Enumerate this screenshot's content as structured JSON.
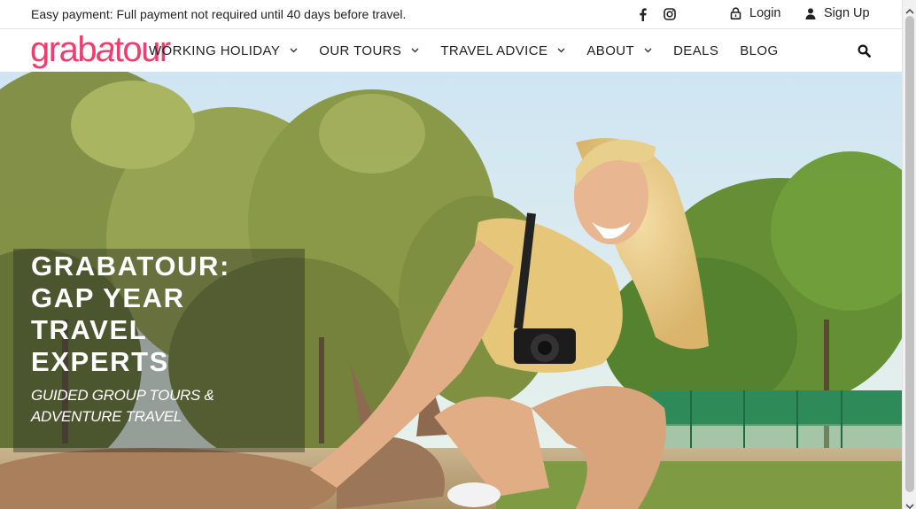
{
  "topbar": {
    "promo": "Easy payment: Full payment not required until 40 days before travel.",
    "login_label": "Login",
    "signup_label": "Sign Up"
  },
  "brand": {
    "logo_parts": [
      "grab",
      "a",
      "tour"
    ],
    "accent_color": "#ef3d6d"
  },
  "nav": {
    "items": [
      {
        "label": "WORKING HOLIDAY",
        "has_dropdown": true
      },
      {
        "label": "OUR TOURS",
        "has_dropdown": true
      },
      {
        "label": "TRAVEL ADVICE",
        "has_dropdown": true
      },
      {
        "label": "ABOUT",
        "has_dropdown": true
      },
      {
        "label": "DEALS",
        "has_dropdown": false
      },
      {
        "label": "BLOG",
        "has_dropdown": false
      }
    ]
  },
  "icons": {
    "facebook": "facebook-icon",
    "instagram": "instagram-icon",
    "login": "lock-icon",
    "signup": "user-icon",
    "search": "search-icon"
  },
  "hero": {
    "title_lines": [
      "GRABATOUR:",
      "GAP YEAR",
      "TRAVEL",
      "EXPERTS"
    ],
    "subtitle_lines": [
      "GUIDED GROUP TOURS &",
      "ADVENTURE TRAVEL"
    ]
  }
}
